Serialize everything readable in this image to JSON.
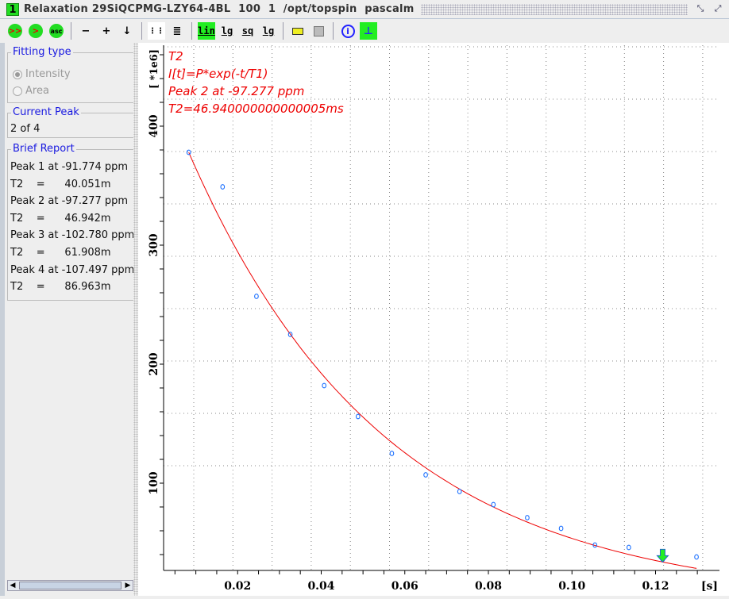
{
  "window": {
    "number": "1",
    "title": "Relaxation 29SiQCPMG-LZY64-4BL  100  1  /opt/topspin  pascalm"
  },
  "toolbar": {
    "buttons": [
      {
        "name": "fit-all-button",
        "label": ">>"
      },
      {
        "name": "fit-next-button",
        "label": ">"
      },
      {
        "name": "ascii-button",
        "label": "asc"
      },
      {
        "name": "minus-button",
        "label": "−"
      },
      {
        "name": "plus-button",
        "label": "+"
      },
      {
        "name": "down-button",
        "label": "↓"
      },
      {
        "name": "lin-button",
        "label": "lin",
        "active": true
      },
      {
        "name": "log-button",
        "label": "lg"
      },
      {
        "name": "sq-button",
        "label": "sq"
      },
      {
        "name": "log-x-button",
        "label": "lg"
      }
    ]
  },
  "left": {
    "fitting_type": {
      "title": "Fitting type",
      "options": [
        {
          "label": "Intensity",
          "selected": true
        },
        {
          "label": "Area",
          "selected": false
        }
      ]
    },
    "current_peak": {
      "title": "Current Peak",
      "value": "2 of 4"
    },
    "brief_report": {
      "title": "Brief Report",
      "lines": [
        "Peak 1 at -91.774 ppm",
        "T2    =      40.051m",
        "Peak 2 at -97.277 ppm",
        "T2    =      46.942m",
        "Peak 3 at -102.780 ppm",
        "T2    =      61.908m",
        "Peak 4 at -107.497 ppm",
        "T2    =      86.963m"
      ]
    }
  },
  "chart_data": {
    "type": "scatter",
    "annotations": [
      "T2",
      "I[t]=P*exp(-t/T1)",
      "Peak 2 at -97.277 ppm",
      "T2=46.940000000000005ms"
    ],
    "ylabel": "[ *1e6]",
    "xlabel": "[s]",
    "xlim": [
      0.0,
      0.135
    ],
    "ylim": [
      26.7,
      468
    ],
    "xticks": [
      "0.02",
      "0.04",
      "0.06",
      "0.08",
      "0.10",
      "0.12"
    ],
    "xtick_values": [
      0.02,
      0.04,
      0.06,
      0.08,
      0.1,
      0.12
    ],
    "yticks": [
      "100",
      "200",
      "300",
      "400"
    ],
    "ytick_values": [
      100,
      200,
      300,
      400
    ],
    "points": {
      "x": [
        0.0083,
        0.0164,
        0.0245,
        0.0326,
        0.0407,
        0.0488,
        0.0569,
        0.065,
        0.0731,
        0.0812,
        0.0893,
        0.0974,
        0.1055,
        0.1136,
        0.1217,
        0.1298
      ],
      "y": [
        378,
        349,
        257,
        225,
        182,
        156,
        125,
        107,
        93,
        82,
        71,
        62,
        48,
        46,
        36,
        38
      ]
    },
    "fit": {
      "P": 451,
      "T2": 0.04694
    },
    "colors": {
      "points": "#1a6fff",
      "fit": "#ee0000",
      "annotation": "#ee0000",
      "marker": "#22ee22"
    },
    "marker_point_index": 14,
    "grid": true
  }
}
